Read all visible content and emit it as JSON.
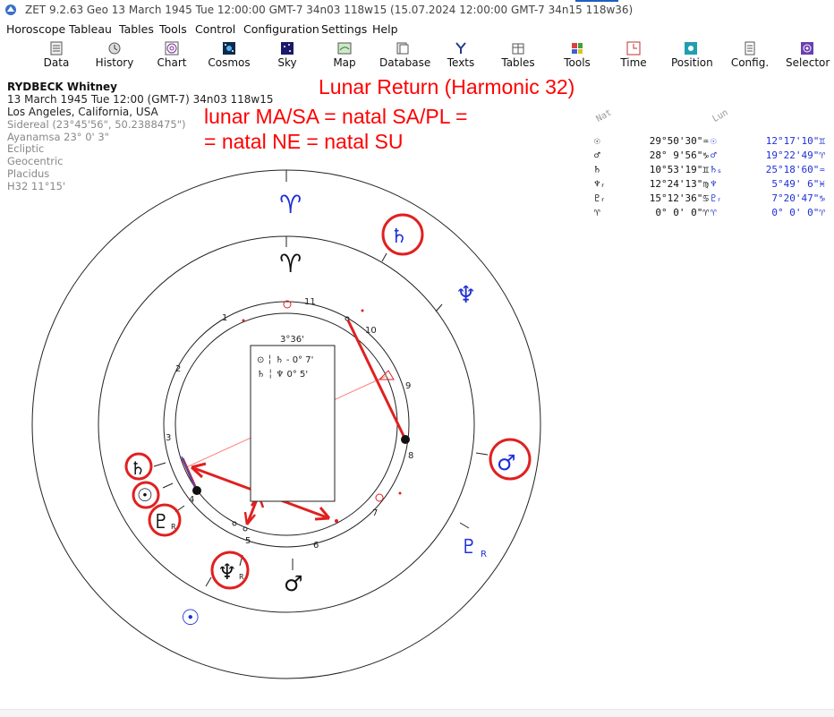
{
  "window": {
    "title": "ZET 9.2.63 Geo   13 March 1945  Tue  12:00:00 GMT-7 34n03  118w15  (15.07.2024  12:00:00 GMT-7 34n15 118w36)"
  },
  "menu": [
    "Horoscope",
    "Tableau",
    "Tables",
    "Tools",
    "Control",
    "Configuration",
    "Settings",
    "Help"
  ],
  "toolbar": [
    {
      "label": "Data",
      "icon": "data-icon"
    },
    {
      "label": "History",
      "icon": "history-icon"
    },
    {
      "label": "Chart",
      "icon": "chart-icon"
    },
    {
      "label": "Cosmos",
      "icon": "cosmos-icon"
    },
    {
      "label": "Sky",
      "icon": "sky-icon"
    },
    {
      "label": "Map",
      "icon": "map-icon"
    },
    {
      "label": "Database",
      "icon": "database-icon"
    },
    {
      "label": "Texts",
      "icon": "texts-icon"
    },
    {
      "label": "Tables",
      "icon": "tables-icon"
    },
    {
      "label": "Tools",
      "icon": "tools-icon"
    },
    {
      "label": "Time",
      "icon": "time-icon"
    },
    {
      "label": "Position",
      "icon": "position-icon"
    },
    {
      "label": "Config.",
      "icon": "config-icon"
    },
    {
      "label": "Selector",
      "icon": "selector-icon"
    }
  ],
  "info": {
    "name": "RYDBECK Whitney",
    "datetime": "13 March 1945  Tue  12:00 (GMT-7) 34n03  118w15",
    "place": "Los Angeles, California, USA",
    "settings": [
      "Sidereal (23°45'56\", 50.2388475\")",
      "Ayanamsa 23° 0' 3\"",
      "Ecliptic",
      "Geocentric",
      "Placidus",
      "H32  11°15'"
    ]
  },
  "annotation": {
    "title": "Lunar Return (Harmonic 32)",
    "line1": "lunar MA/SA = natal SA/PL =",
    "line2": "= natal NE = natal SU"
  },
  "aspect_box": {
    "header": "3°36'",
    "rows": [
      {
        "text": "⊙ ╎ ♄ - 0° 7'"
      },
      {
        "text": "♄ ╎ ♆   0° 5'"
      }
    ]
  },
  "table": {
    "header_natal": "Nat",
    "header_lunar": "Lun",
    "rows": [
      {
        "natal_glyph": "☉",
        "natal_pos": "29°50'30\"♒",
        "lunar_glyph": "☉",
        "lunar_pos": "12°17'10\"♊"
      },
      {
        "natal_glyph": "♂",
        "natal_pos": "28° 9'56\"♑",
        "lunar_glyph": "♂",
        "lunar_pos": "19°22'49\"♈"
      },
      {
        "natal_glyph": "♄",
        "natal_pos": "10°53'19\"♊",
        "lunar_glyph": "♄ₛ",
        "lunar_pos": "25°18'60\"♒"
      },
      {
        "natal_glyph": "♆ᵣ",
        "natal_pos": "12°24'13\"♍",
        "lunar_glyph": "♆",
        "lunar_pos": "5°49' 6\"♓"
      },
      {
        "natal_glyph": "♇ᵣ",
        "natal_pos": "15°12'36\"♋",
        "lunar_glyph": "♇ᵣ",
        "lunar_pos": "7°20'47\"♑"
      },
      {
        "natal_glyph": "♈",
        "natal_pos": "0° 0' 0\"♈",
        "lunar_glyph": "♈",
        "lunar_pos": "0° 0' 0\"♈"
      }
    ]
  },
  "chart_wheel": {
    "house_numbers": [
      "1",
      "2",
      "3",
      "4",
      "5",
      "6",
      "7",
      "8",
      "9",
      "10",
      "11"
    ],
    "outer_glyphs": [
      {
        "glyph": "♈",
        "color": "#1e2fd6"
      },
      {
        "glyph": "♄",
        "color": "#1e2fd6"
      },
      {
        "glyph": "♆",
        "color": "#1e2fd6"
      },
      {
        "glyph": "♂",
        "color": "#1e2fd6"
      },
      {
        "glyph": "♇",
        "sub": "R",
        "color": "#1e2fd6"
      },
      {
        "glyph": "☉",
        "color": "#1e2fd6"
      }
    ],
    "inner_glyphs": [
      {
        "glyph": "♈",
        "color": "#111111"
      },
      {
        "glyph": "♄",
        "color": "#111111"
      },
      {
        "glyph": "☉",
        "color": "#111111"
      },
      {
        "glyph": "♇",
        "sub": "R",
        "color": "#111111"
      },
      {
        "glyph": "♆",
        "sub": "R",
        "color": "#111111"
      },
      {
        "glyph": "♂",
        "color": "#111111"
      }
    ]
  },
  "colors": {
    "annotation": "#ff0000",
    "lunar": "#1e2fd6",
    "natal": "#111111"
  }
}
